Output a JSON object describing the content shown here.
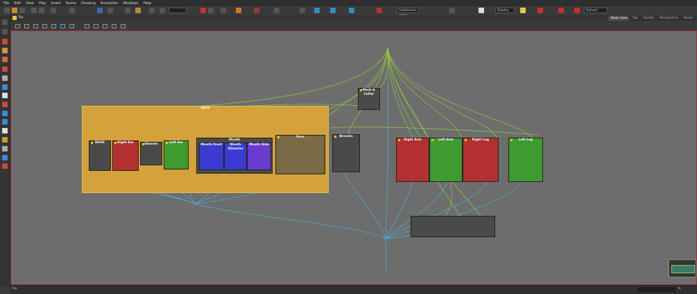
{
  "menu": [
    "File",
    "Edit",
    "View",
    "Play",
    "Insert",
    "Scene",
    "Drawing",
    "Animation",
    "Windows",
    "Help"
  ],
  "toolbar": {
    "subdivision": "Subdivision (OFF)",
    "display": "Display",
    "preset": "Default"
  },
  "tab": {
    "label": "Top"
  },
  "view_tabs": [
    "Node View",
    "Top",
    "Guides",
    "Perspective",
    "Shoes"
  ],
  "status": {
    "left": "Top"
  },
  "zoom_label": "%",
  "colors": {
    "canvas": "#6d6d6d",
    "head": "#d4a23a",
    "red": "#b23030",
    "green": "#3f9a30",
    "blue": "#3b3bd1",
    "purple": "#6a3bd1",
    "dark": "#4a4a4a",
    "brown": "#7a6a45",
    "wire_blue": "#4ab4e6",
    "wire_green": "#9ad43a"
  },
  "nodes": {
    "head": "Head",
    "nose": "NOSE",
    "right_ear": "Right Ear",
    "glasses": "Glasses",
    "left_ear": "Left Ear",
    "mouth": "Mouth",
    "mouth_front": "Mouth Front",
    "mouth_3quarter": "Mouth 3Quarter",
    "mouth_side": "Mouth Side",
    "face": "Face",
    "neck_collar": "Neck & Collar",
    "breasts": "Breasts",
    "right_arm": "Right Arm",
    "left_arm": "Left Arm",
    "right_leg": "Right Leg",
    "left_leg": "Left Leg"
  }
}
